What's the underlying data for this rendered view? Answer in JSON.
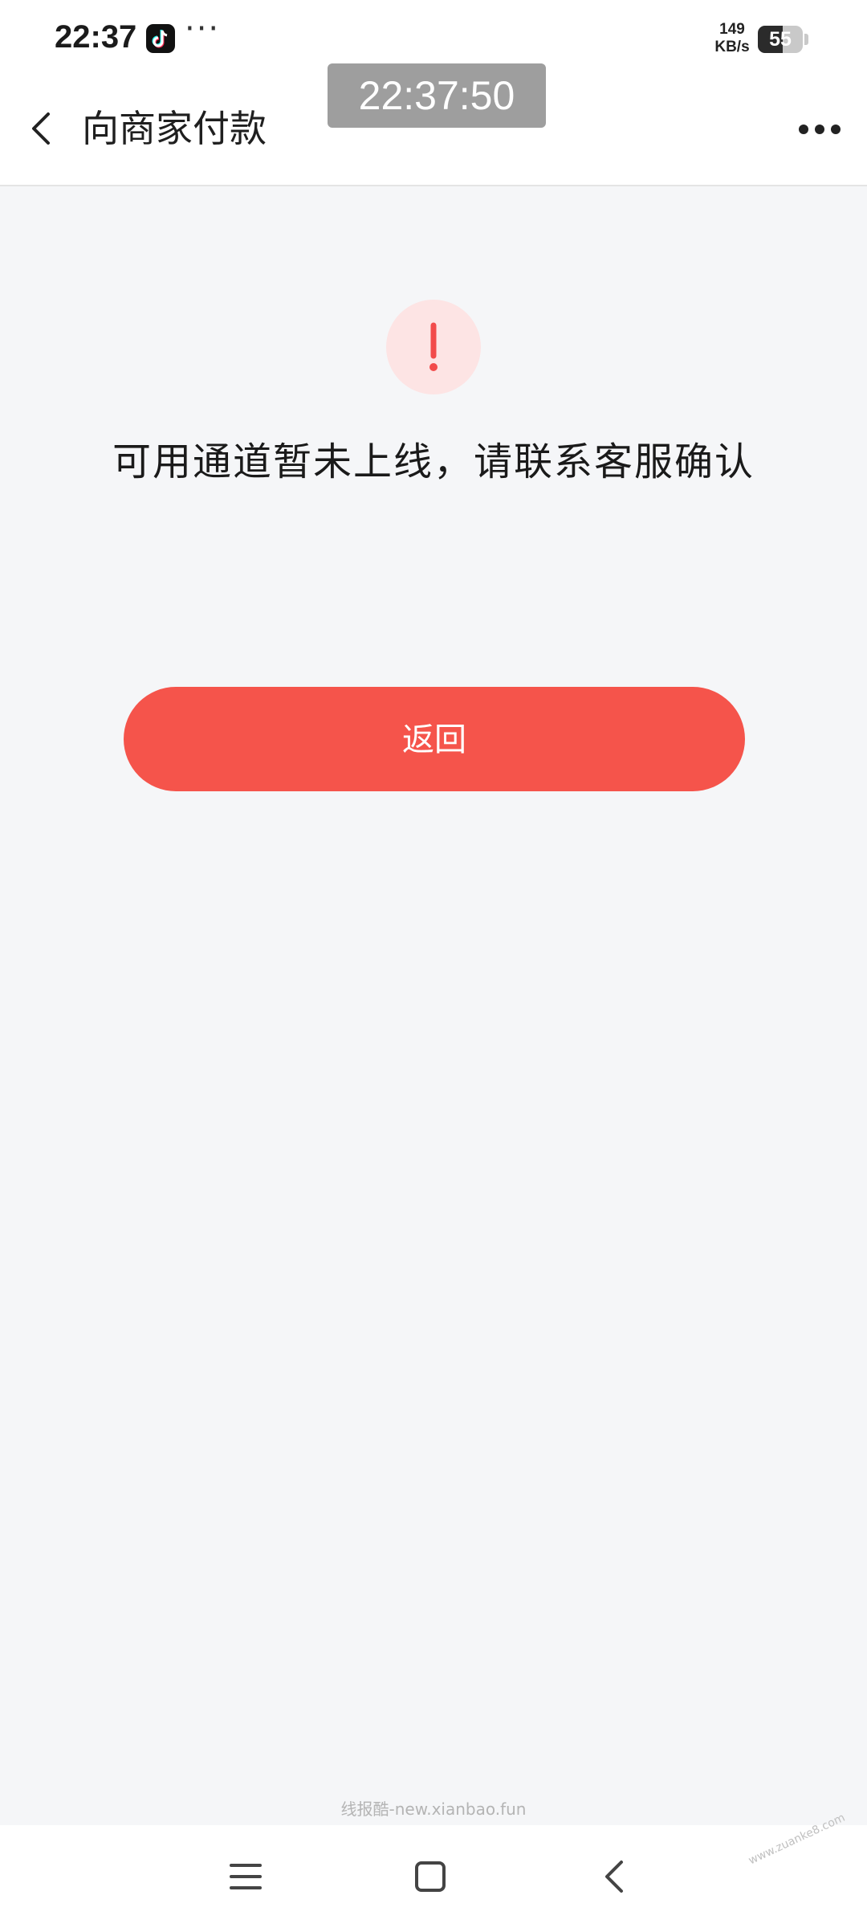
{
  "status_bar": {
    "time": "22:37",
    "app_icon": "tiktok-icon",
    "more_indicator": "···",
    "net_speed_value": "149",
    "net_speed_unit": "KB/s",
    "battery_level": "55",
    "battery_percent": 55
  },
  "header": {
    "back_icon": "chevron-left-icon",
    "title": "向商家付款",
    "more_icon": "more-dots-icon"
  },
  "timer_overlay": {
    "text": "22:37:50"
  },
  "main": {
    "alert_icon": "exclamation-icon",
    "message": "可用通道暂未上线，请联系客服确认",
    "return_button": "返回"
  },
  "footer": {
    "watermark": "线报酷-new.xianbao.fun",
    "corner_stamp": "www.zuanke8.com"
  },
  "nav_bar": {
    "menu_icon": "menu-icon",
    "home_icon": "home-square-icon",
    "back_icon": "back-triangle-icon"
  },
  "colors": {
    "accent": "#f5544b",
    "alert_bg": "#fde4e4",
    "page_bg": "#f5f6f8"
  }
}
